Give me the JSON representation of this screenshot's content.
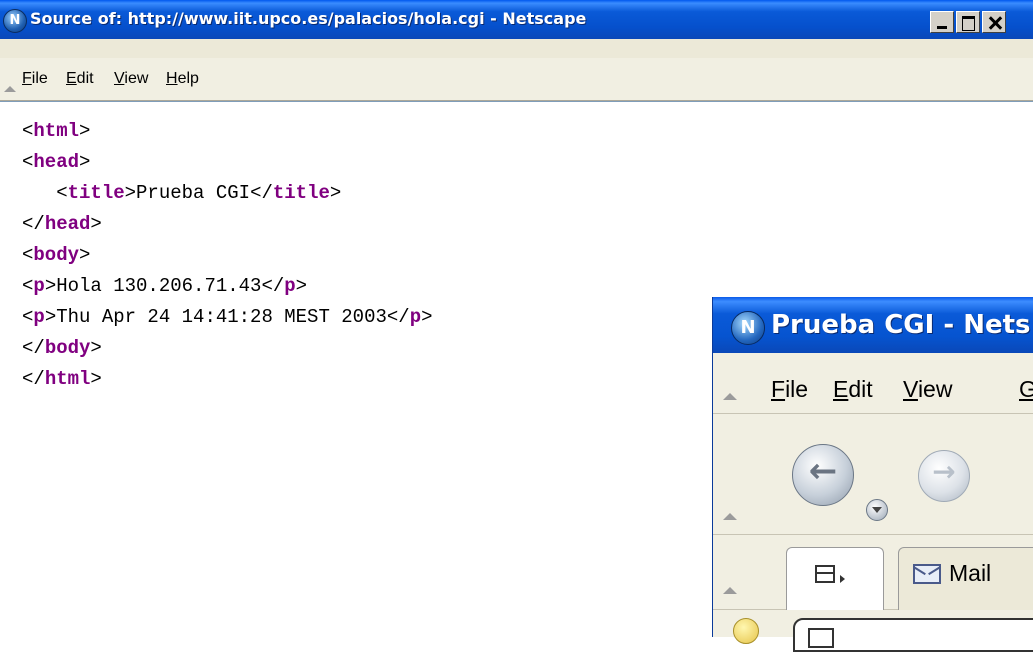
{
  "source_window": {
    "title": "Source of: http://www.iit.upco.es/palacios/hola.cgi - Netscape",
    "menu": [
      {
        "mnemonic": "F",
        "rest": "ile"
      },
      {
        "mnemonic": "E",
        "rest": "dit"
      },
      {
        "mnemonic": "V",
        "rest": "iew"
      },
      {
        "mnemonic": "H",
        "rest": "elp"
      }
    ],
    "code": [
      {
        "pre": "<",
        "tag": "html",
        "post": ">",
        "mid": "",
        "pre2": "",
        "tag2": "",
        "post2": ""
      },
      {
        "pre": "<",
        "tag": "head",
        "post": ">",
        "mid": "",
        "pre2": "",
        "tag2": "",
        "post2": ""
      },
      {
        "pre": "   <",
        "tag": "title",
        "post": ">",
        "mid": "Prueba CGI",
        "pre2": "</",
        "tag2": "title",
        "post2": ">"
      },
      {
        "pre": "</",
        "tag": "head",
        "post": ">",
        "mid": "",
        "pre2": "",
        "tag2": "",
        "post2": ""
      },
      {
        "pre": "<",
        "tag": "body",
        "post": ">",
        "mid": "",
        "pre2": "",
        "tag2": "",
        "post2": ""
      },
      {
        "pre": "<",
        "tag": "p",
        "post": ">",
        "mid": "Hola 130.206.71.43",
        "pre2": "</",
        "tag2": "p",
        "post2": ">"
      },
      {
        "pre": "<",
        "tag": "p",
        "post": ">",
        "mid": "Thu Apr 24 14:41:28 MEST 2003",
        "pre2": "</",
        "tag2": "p",
        "post2": ">"
      },
      {
        "pre": "</",
        "tag": "body",
        "post": ">",
        "mid": "",
        "pre2": "",
        "tag2": "",
        "post2": ""
      },
      {
        "pre": "</",
        "tag": "html",
        "post": ">",
        "mid": "",
        "pre2": "",
        "tag2": "",
        "post2": ""
      }
    ]
  },
  "browser_window": {
    "title": "Prueba CGI - Nets",
    "menu": [
      {
        "mnemonic": "F",
        "rest": "ile"
      },
      {
        "mnemonic": "E",
        "rest": "dit"
      },
      {
        "mnemonic": "V",
        "rest": "iew"
      },
      {
        "mnemonic": "G",
        "rest": ""
      }
    ],
    "tabs": {
      "mail_label": "Mail"
    }
  },
  "colors": {
    "titlebar": "#0a5ad8",
    "tag_purple": "#800080",
    "chrome": "#ece9d8"
  },
  "icons": {
    "app_icon": "netscape-logo-icon",
    "back": "back-arrow-icon",
    "forward": "forward-arrow-icon",
    "mail": "mail-envelope-icon"
  }
}
